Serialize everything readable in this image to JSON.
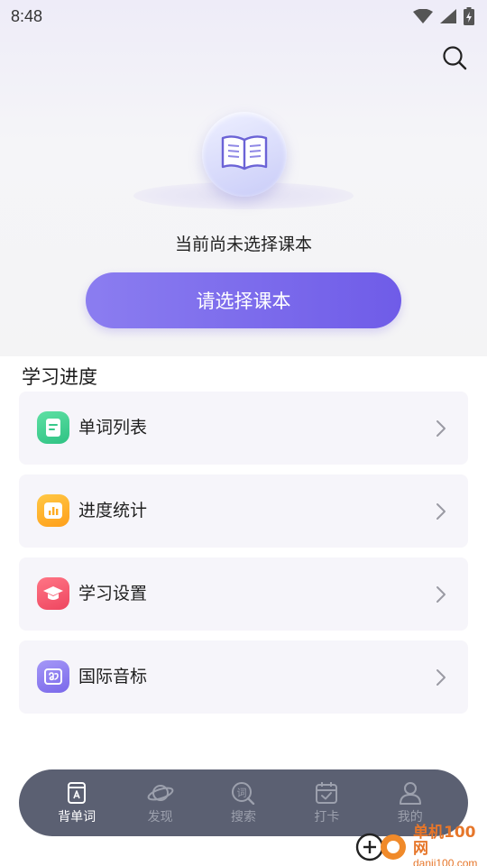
{
  "status_bar": {
    "time": "8:48",
    "icons": [
      "wifi-icon",
      "signal-icon",
      "battery-charging-icon"
    ]
  },
  "header": {
    "search_icon": "search-icon"
  },
  "hero": {
    "book_icon": "open-book-icon",
    "empty_text": "当前尚未选择课本",
    "select_button_label": "请选择课本"
  },
  "progress": {
    "title": "学习进度",
    "items": [
      {
        "label": "单词列表",
        "icon": "word-list-icon",
        "color": "#3ecf8e"
      },
      {
        "label": "进度统计",
        "icon": "stats-chart-icon",
        "color": "#ffb020"
      },
      {
        "label": "学习设置",
        "icon": "graduation-cap-icon",
        "color": "#f45b6e"
      },
      {
        "label": "国际音标",
        "icon": "phonetic-icon",
        "color": "#8a7cf0"
      }
    ]
  },
  "bottom_nav": {
    "items": [
      {
        "label": "背单词",
        "icon": "vocabulary-book-icon",
        "active": true
      },
      {
        "label": "发现",
        "icon": "planet-icon",
        "active": false
      },
      {
        "label": "搜索",
        "icon": "word-search-icon",
        "active": false
      },
      {
        "label": "打卡",
        "icon": "calendar-check-icon",
        "active": false
      },
      {
        "label": "我的",
        "icon": "person-icon",
        "active": false
      }
    ]
  },
  "watermark": {
    "main": "单机100网",
    "sub": "danji100.com"
  },
  "colors": {
    "accent": "#7b6cef",
    "nav_bg": "#5b6072",
    "watermark": "#e6762a"
  }
}
